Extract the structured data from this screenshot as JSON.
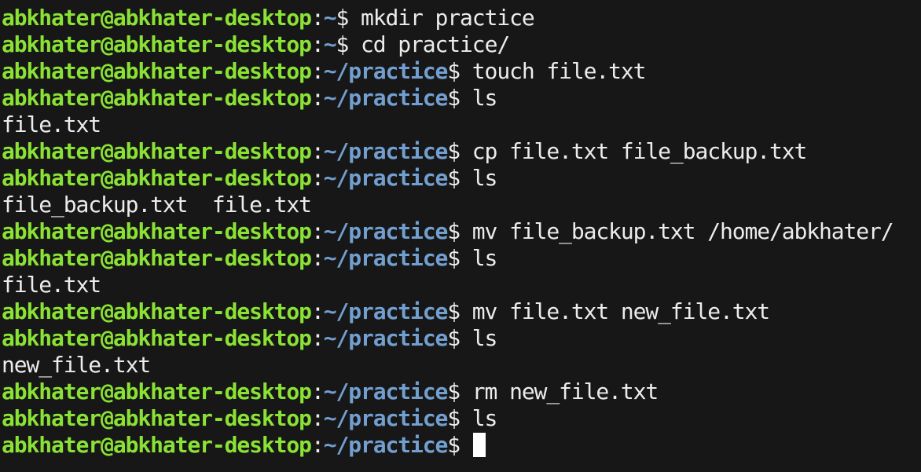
{
  "theme": {
    "background": "#171717",
    "user_color": "#8ae234",
    "path_color": "#729fcf",
    "text_color": "#ececec"
  },
  "terminal": {
    "lines": [
      {
        "type": "prompt",
        "user": "abkhater@abkhater-desktop",
        "colon": ":",
        "path": "~",
        "symbol": "$",
        "command": " mkdir practice"
      },
      {
        "type": "prompt",
        "user": "abkhater@abkhater-desktop",
        "colon": ":",
        "path": "~",
        "symbol": "$",
        "command": " cd practice/"
      },
      {
        "type": "prompt",
        "user": "abkhater@abkhater-desktop",
        "colon": ":",
        "path": "~/practice",
        "symbol": "$",
        "command": " touch file.txt"
      },
      {
        "type": "prompt",
        "user": "abkhater@abkhater-desktop",
        "colon": ":",
        "path": "~/practice",
        "symbol": "$",
        "command": " ls"
      },
      {
        "type": "output",
        "text": "file.txt"
      },
      {
        "type": "prompt",
        "user": "abkhater@abkhater-desktop",
        "colon": ":",
        "path": "~/practice",
        "symbol": "$",
        "command": " cp file.txt file_backup.txt"
      },
      {
        "type": "prompt",
        "user": "abkhater@abkhater-desktop",
        "colon": ":",
        "path": "~/practice",
        "symbol": "$",
        "command": " ls"
      },
      {
        "type": "output",
        "text": "file_backup.txt  file.txt"
      },
      {
        "type": "prompt",
        "user": "abkhater@abkhater-desktop",
        "colon": ":",
        "path": "~/practice",
        "symbol": "$",
        "command": " mv file_backup.txt /home/abkhater/"
      },
      {
        "type": "prompt",
        "user": "abkhater@abkhater-desktop",
        "colon": ":",
        "path": "~/practice",
        "symbol": "$",
        "command": " ls"
      },
      {
        "type": "output",
        "text": "file.txt"
      },
      {
        "type": "prompt",
        "user": "abkhater@abkhater-desktop",
        "colon": ":",
        "path": "~/practice",
        "symbol": "$",
        "command": " mv file.txt new_file.txt"
      },
      {
        "type": "prompt",
        "user": "abkhater@abkhater-desktop",
        "colon": ":",
        "path": "~/practice",
        "symbol": "$",
        "command": " ls"
      },
      {
        "type": "output",
        "text": "new_file.txt"
      },
      {
        "type": "prompt",
        "user": "abkhater@abkhater-desktop",
        "colon": ":",
        "path": "~/practice",
        "symbol": "$",
        "command": " rm new_file.txt"
      },
      {
        "type": "prompt",
        "user": "abkhater@abkhater-desktop",
        "colon": ":",
        "path": "~/practice",
        "symbol": "$",
        "command": " ls"
      },
      {
        "type": "active-prompt",
        "user": "abkhater@abkhater-desktop",
        "colon": ":",
        "path": "~/practice",
        "symbol": "$",
        "command": ""
      }
    ]
  }
}
